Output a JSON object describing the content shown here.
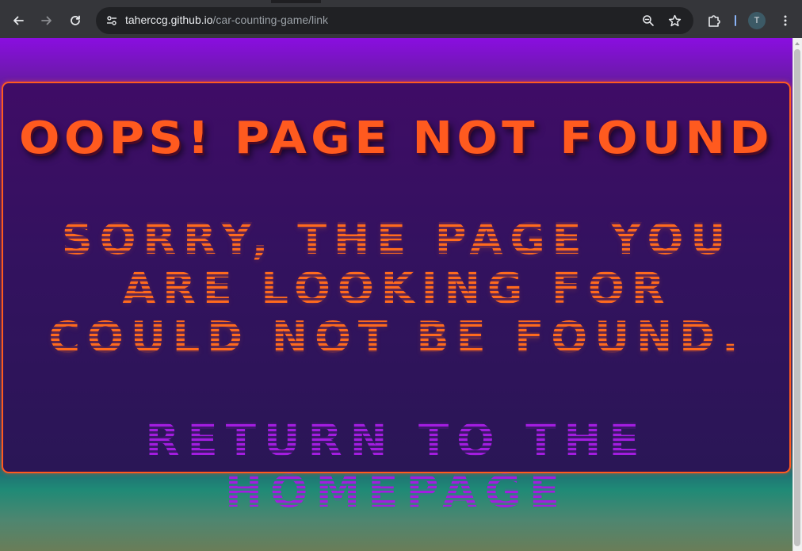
{
  "browser": {
    "url_host": "taherccg.github.io",
    "url_path": "/car-counting-game/link",
    "profile_initial": "T",
    "icons": {
      "back": "arrow-left-icon",
      "forward": "arrow-right-icon",
      "reload": "reload-icon",
      "site_info": "tune-icon",
      "zoom": "zoom-out-icon",
      "bookmark": "star-icon",
      "extensions": "puzzle-icon",
      "menu": "kebab-menu-icon"
    }
  },
  "page": {
    "title": "Oops! Page Not Found",
    "message": "Sorry, the page you are looking for could not be found.",
    "home_link": "Return to the Homepage"
  },
  "colors": {
    "accent_orange": "#ff5a1f",
    "link_purple": "#a31de0",
    "card_bg": "#3f0c66"
  }
}
